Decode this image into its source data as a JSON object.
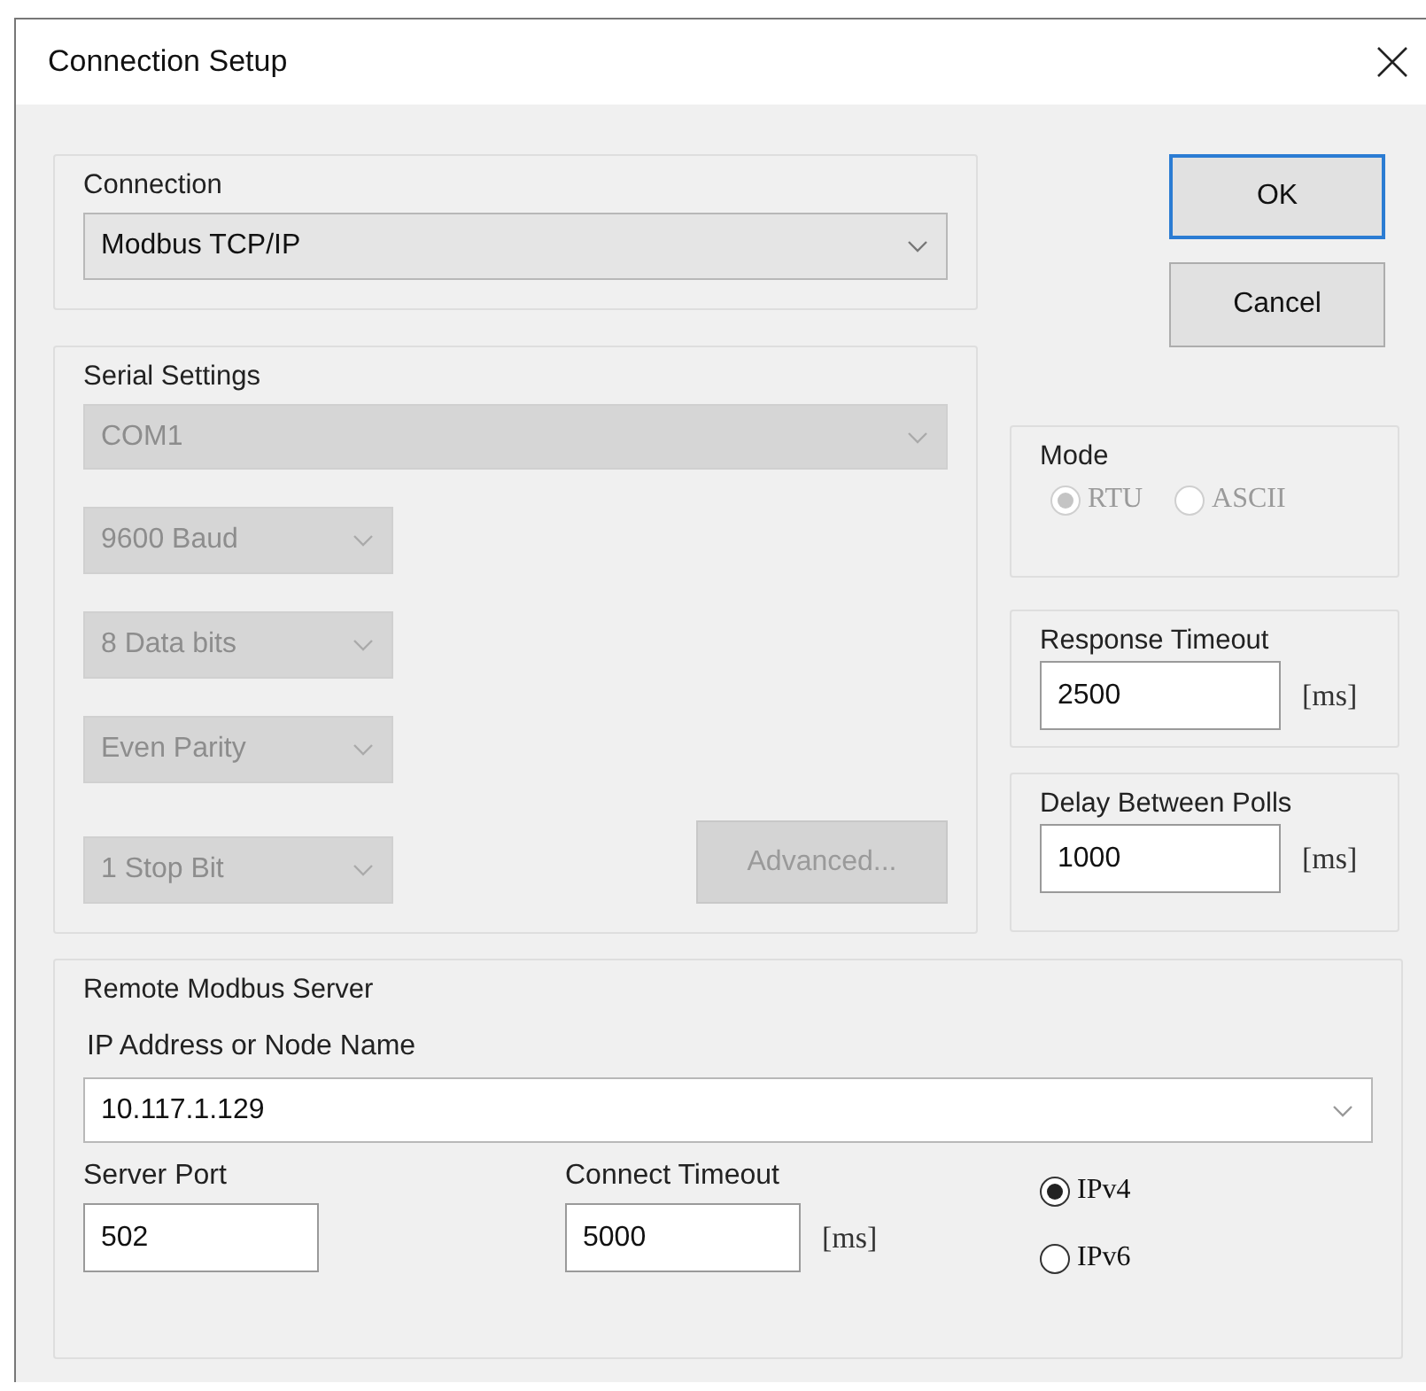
{
  "window": {
    "title": "Connection Setup"
  },
  "connection": {
    "label": "Connection",
    "value": "Modbus TCP/IP"
  },
  "serial_settings": {
    "label": "Serial Settings",
    "disabled": true,
    "port": "COM1",
    "fields": [
      "9600 Baud",
      "8 Data bits",
      "Even Parity",
      "1 Stop Bit"
    ],
    "advanced_button": "Advanced..."
  },
  "buttons": [
    {
      "label": "OK",
      "default": true
    },
    {
      "label": "Cancel",
      "default": false
    }
  ],
  "mode": {
    "label": "Mode",
    "disabled": true,
    "options": [
      {
        "label": "RTU",
        "selected": true
      },
      {
        "label": "ASCII",
        "selected": false
      }
    ]
  },
  "response_timeout": {
    "label": "Response Timeout",
    "value": "2500",
    "unit": "[ms]"
  },
  "delay_between_polls": {
    "label": "Delay Between Polls",
    "value": "1000",
    "unit": "[ms]"
  },
  "remote_server": {
    "label": "Remote Modbus Server",
    "address_label": "IP Address or Node Name",
    "address": "10.117.1.129",
    "port_label": "Server Port",
    "port": "502",
    "timeout_label": "Connect Timeout",
    "timeout": "5000",
    "timeout_unit": "[ms]",
    "ip_versions": [
      {
        "label": "IPv4",
        "selected": true
      },
      {
        "label": "IPv6",
        "selected": false
      }
    ]
  }
}
